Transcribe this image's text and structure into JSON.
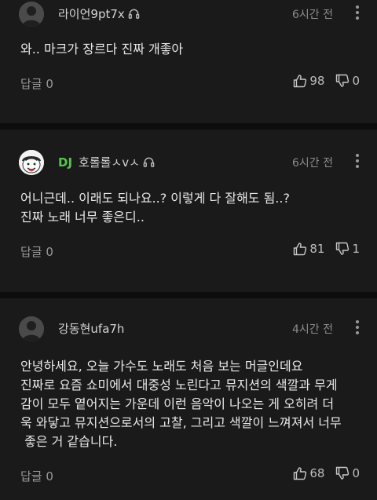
{
  "comments": [
    {
      "nickname": "라이언9pt7x",
      "time": "6시간 전",
      "text": "와.. 마크가 장르다 진짜 개좋아",
      "reply": "답글 0",
      "likes": "98",
      "dislikes": "0",
      "avatar": "default-person-icon",
      "badge": ""
    },
    {
      "badge": "DJ",
      "nickname": "호롤롤ㅅvㅅ",
      "time": "6시간 전",
      "text": "어니근데.. 이래도 되나요..? 이렇게 다 잘해도 됨..?\n진짜 노래 너무 좋은디..",
      "reply": "답글 0",
      "likes": "81",
      "dislikes": "1",
      "avatar": "cartoon-face-avatar"
    },
    {
      "nickname": "강동현ufa7h",
      "time": "4시간 전",
      "text": "안녕하세요, 오늘 가수도 노래도 처음 보는 머글인데요\n진짜로 요즘 쇼미에서 대중성 노린다고 뮤지션의 색깔과 무게\n감이 모두 옅어지는 가운데 이런 음악이 나오는 게 오히려 더\n욱 와닿고 뮤지션으로서의 고찰, 그리고 색깔이 느껴져서 너무\n 좋은 거 같습니다.",
      "reply": "답글 0",
      "likes": "68",
      "dislikes": "0",
      "avatar": "default-person-icon",
      "badge": ""
    }
  ],
  "colors": {
    "background": "#1a1a1a",
    "separator": "#0d0d0d",
    "dj_badge": "#56c54a"
  }
}
